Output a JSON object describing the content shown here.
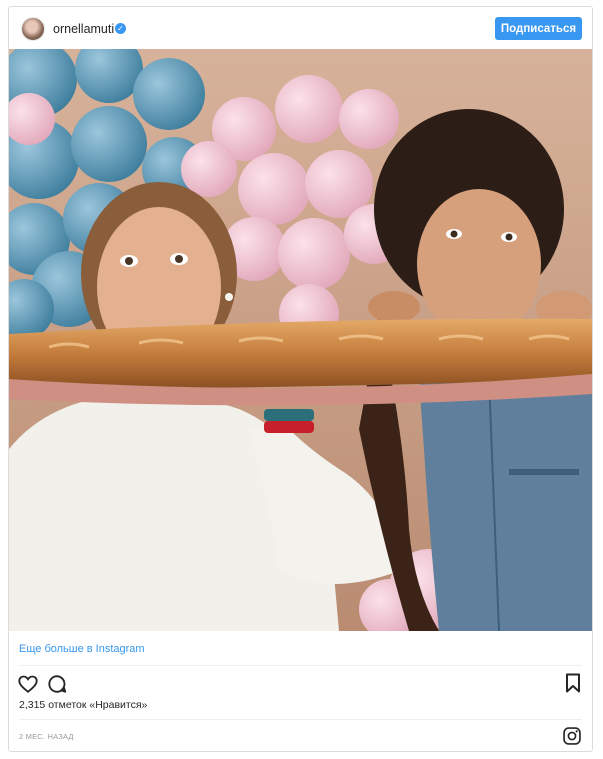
{
  "header": {
    "username": "ornellamuti",
    "verified_mark": "✓",
    "follow_label": "Подписаться"
  },
  "post": {
    "more_link": "Еще больше в Instagram",
    "likes": "2,315 отметок «Нравится»",
    "timestamp": "2 МЕС. НАЗАД"
  },
  "icons": {
    "heart": "heart-icon",
    "comment": "comment-icon",
    "bookmark": "bookmark-icon",
    "instagram": "instagram-icon",
    "verified": "verified-badge-icon"
  },
  "colors": {
    "accent": "#3897f0",
    "border": "#dbdbdb",
    "muted": "#999999",
    "text": "#262626"
  }
}
